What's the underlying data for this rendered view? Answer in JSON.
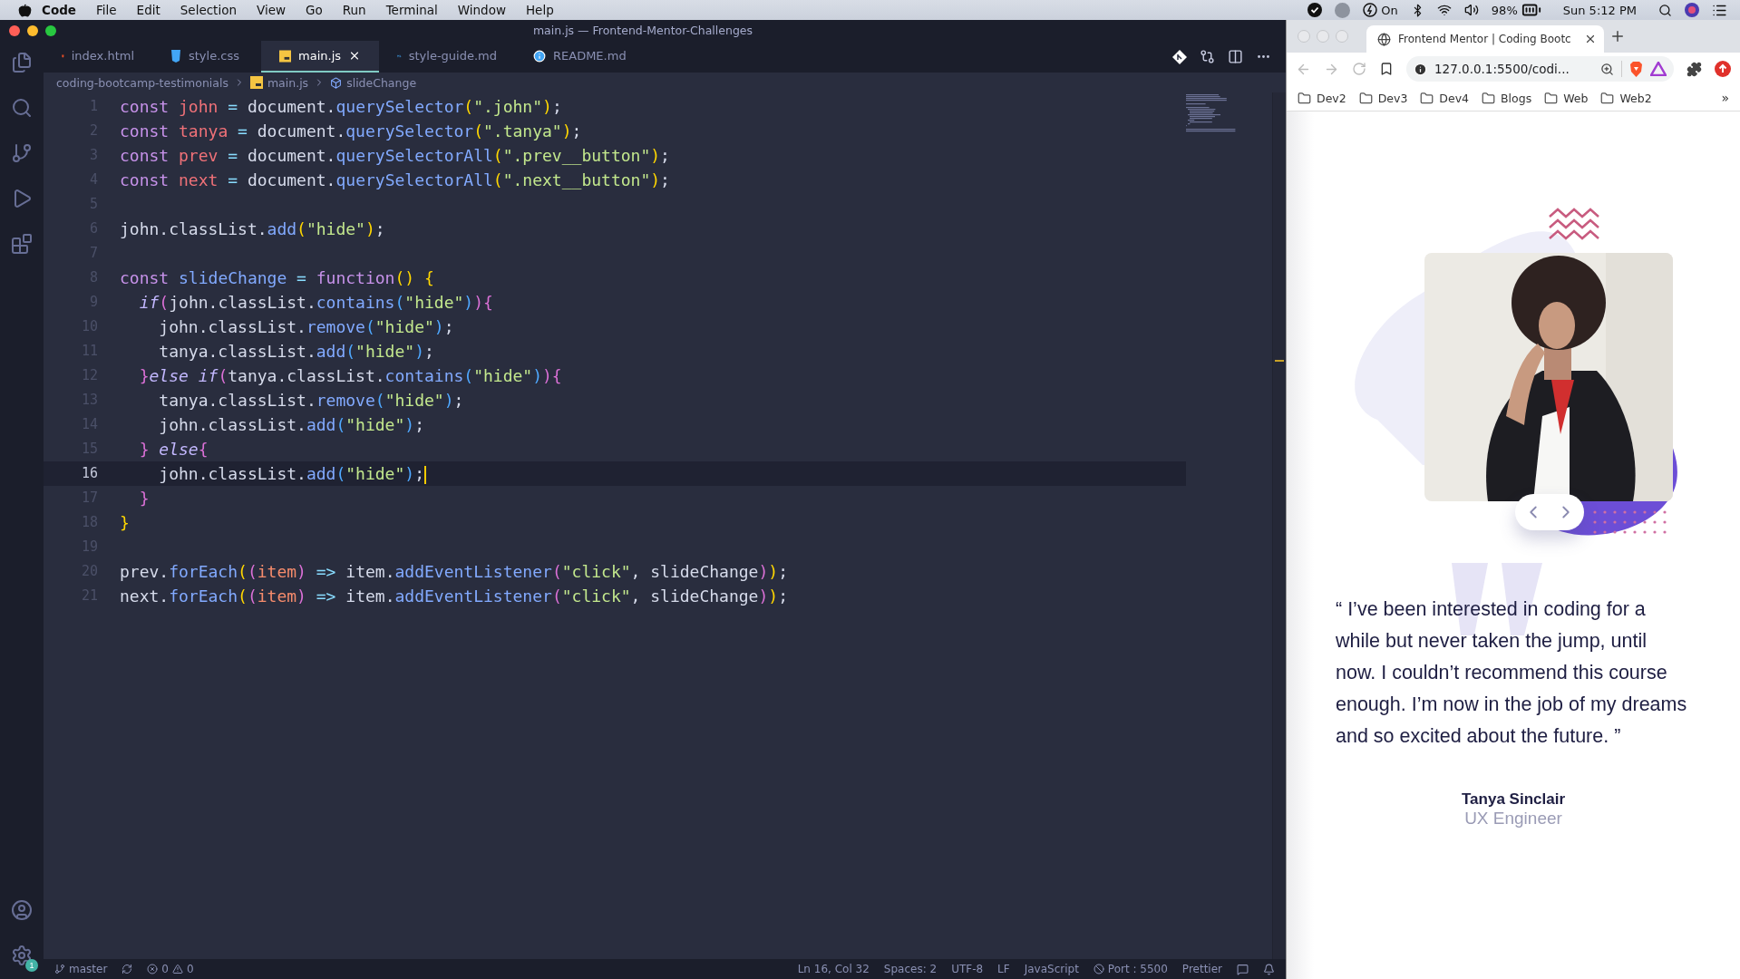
{
  "menubar": {
    "app": "Code",
    "menus": [
      "File",
      "Edit",
      "Selection",
      "View",
      "Go",
      "Run",
      "Terminal",
      "Window",
      "Help"
    ],
    "focus": "On",
    "battery": "98%",
    "clock": "Sun 5:12 PM"
  },
  "editor": {
    "title": "main.js — Frontend-Mentor-Challenges",
    "tabs": [
      {
        "label": "index.html",
        "kind": "html",
        "selected": false
      },
      {
        "label": "style.css",
        "kind": "css",
        "selected": false
      },
      {
        "label": "main.js",
        "kind": "js",
        "selected": true
      },
      {
        "label": "style-guide.md",
        "kind": "md",
        "selected": false
      },
      {
        "label": "README.md",
        "kind": "info",
        "selected": false
      }
    ],
    "breadcrumb": [
      {
        "label": "coding-bootcamp-testimonials",
        "kind": "folder"
      },
      {
        "label": "main.js",
        "kind": "js"
      },
      {
        "label": "slideChange",
        "kind": "symbol"
      }
    ],
    "settings_badge": "1",
    "lines": [
      {
        "number": "1",
        "current": false,
        "tokens": [
          {
            "kind": "kw",
            "s": "const "
          },
          {
            "kind": "var",
            "s": "john"
          },
          {
            "kind": "op",
            "s": " = "
          },
          {
            "kind": "pl",
            "s": "document."
          },
          {
            "kind": "fn",
            "s": "querySelector"
          },
          {
            "kind": "p1",
            "s": "("
          },
          {
            "kind": "str",
            "s": "\".john\""
          },
          {
            "kind": "p1",
            "s": ")"
          },
          {
            "kind": "pl",
            "s": ";"
          }
        ]
      },
      {
        "number": "2",
        "current": false,
        "tokens": [
          {
            "kind": "kw",
            "s": "const "
          },
          {
            "kind": "var",
            "s": "tanya"
          },
          {
            "kind": "op",
            "s": " = "
          },
          {
            "kind": "pl",
            "s": "document."
          },
          {
            "kind": "fn",
            "s": "querySelector"
          },
          {
            "kind": "p1",
            "s": "("
          },
          {
            "kind": "str",
            "s": "\".tanya\""
          },
          {
            "kind": "p1",
            "s": ")"
          },
          {
            "kind": "pl",
            "s": ";"
          }
        ]
      },
      {
        "number": "3",
        "current": false,
        "tokens": [
          {
            "kind": "kw",
            "s": "const "
          },
          {
            "kind": "var",
            "s": "prev"
          },
          {
            "kind": "op",
            "s": " = "
          },
          {
            "kind": "pl",
            "s": "document."
          },
          {
            "kind": "fn",
            "s": "querySelectorAll"
          },
          {
            "kind": "p1",
            "s": "("
          },
          {
            "kind": "str",
            "s": "\".prev__button\""
          },
          {
            "kind": "p1",
            "s": ")"
          },
          {
            "kind": "pl",
            "s": ";"
          }
        ]
      },
      {
        "number": "4",
        "current": false,
        "tokens": [
          {
            "kind": "kw",
            "s": "const "
          },
          {
            "kind": "var",
            "s": "next"
          },
          {
            "kind": "op",
            "s": " = "
          },
          {
            "kind": "pl",
            "s": "document."
          },
          {
            "kind": "fn",
            "s": "querySelectorAll"
          },
          {
            "kind": "p1",
            "s": "("
          },
          {
            "kind": "str",
            "s": "\".next__button\""
          },
          {
            "kind": "p1",
            "s": ")"
          },
          {
            "kind": "pl",
            "s": ";"
          }
        ]
      },
      {
        "number": "5",
        "current": false
      },
      {
        "number": "6",
        "current": false,
        "tokens": [
          {
            "kind": "pl",
            "s": "john.classList."
          },
          {
            "kind": "fn",
            "s": "add"
          },
          {
            "kind": "p1",
            "s": "("
          },
          {
            "kind": "str",
            "s": "\"hide\""
          },
          {
            "kind": "p1",
            "s": ")"
          },
          {
            "kind": "pl",
            "s": ";"
          }
        ]
      },
      {
        "number": "7",
        "current": false
      },
      {
        "number": "8",
        "current": false,
        "tokens": [
          {
            "kind": "kw",
            "s": "const "
          },
          {
            "kind": "fn",
            "s": "slideChange"
          },
          {
            "kind": "op",
            "s": " = "
          },
          {
            "kind": "kw",
            "s": "function"
          },
          {
            "kind": "p1",
            "s": "() {"
          }
        ]
      },
      {
        "number": "9",
        "current": false,
        "tokens": [
          {
            "kind": "ctrl",
            "s": "  if"
          },
          {
            "kind": "p2",
            "s": "("
          },
          {
            "kind": "pl",
            "s": "john.classList."
          },
          {
            "kind": "fn",
            "s": "contains"
          },
          {
            "kind": "p3",
            "s": "("
          },
          {
            "kind": "str",
            "s": "\"hide\""
          },
          {
            "kind": "p3",
            "s": ")"
          },
          {
            "kind": "p2",
            "s": "){"
          }
        ]
      },
      {
        "number": "10",
        "current": false,
        "tokens": [
          {
            "kind": "pl",
            "s": "    john.classList."
          },
          {
            "kind": "fn",
            "s": "remove"
          },
          {
            "kind": "p3",
            "s": "("
          },
          {
            "kind": "str",
            "s": "\"hide\""
          },
          {
            "kind": "p3",
            "s": ")"
          },
          {
            "kind": "pl",
            "s": ";"
          }
        ]
      },
      {
        "number": "11",
        "current": false,
        "tokens": [
          {
            "kind": "pl",
            "s": "    tanya.classList."
          },
          {
            "kind": "fn",
            "s": "add"
          },
          {
            "kind": "p3",
            "s": "("
          },
          {
            "kind": "str",
            "s": "\"hide\""
          },
          {
            "kind": "p3",
            "s": ")"
          },
          {
            "kind": "pl",
            "s": ";"
          }
        ]
      },
      {
        "number": "12",
        "current": false,
        "tokens": [
          {
            "kind": "p2",
            "s": "  }"
          },
          {
            "kind": "ctrl",
            "s": "else if"
          },
          {
            "kind": "p2",
            "s": "("
          },
          {
            "kind": "pl",
            "s": "tanya.classList."
          },
          {
            "kind": "fn",
            "s": "contains"
          },
          {
            "kind": "p3",
            "s": "("
          },
          {
            "kind": "str",
            "s": "\"hide\""
          },
          {
            "kind": "p3",
            "s": ")"
          },
          {
            "kind": "p2",
            "s": "){"
          }
        ]
      },
      {
        "number": "13",
        "current": false,
        "tokens": [
          {
            "kind": "pl",
            "s": "    tanya.classList."
          },
          {
            "kind": "fn",
            "s": "remove"
          },
          {
            "kind": "p3",
            "s": "("
          },
          {
            "kind": "str",
            "s": "\"hide\""
          },
          {
            "kind": "p3",
            "s": ")"
          },
          {
            "kind": "pl",
            "s": ";"
          }
        ]
      },
      {
        "number": "14",
        "current": false,
        "tokens": [
          {
            "kind": "pl",
            "s": "    john.classList."
          },
          {
            "kind": "fn",
            "s": "add"
          },
          {
            "kind": "p3",
            "s": "("
          },
          {
            "kind": "str",
            "s": "\"hide\""
          },
          {
            "kind": "p3",
            "s": ")"
          },
          {
            "kind": "pl",
            "s": ";"
          }
        ]
      },
      {
        "number": "15",
        "current": false,
        "tokens": [
          {
            "kind": "p2",
            "s": "  } "
          },
          {
            "kind": "ctrl",
            "s": "else"
          },
          {
            "kind": "p2",
            "s": "{"
          }
        ]
      },
      {
        "number": "16",
        "current": true,
        "tokens": [
          {
            "kind": "pl",
            "s": "    john.classList."
          },
          {
            "kind": "fn",
            "s": "add"
          },
          {
            "kind": "p3",
            "s": "("
          },
          {
            "kind": "str",
            "s": "\"hide\""
          },
          {
            "kind": "p3",
            "s": ")"
          },
          {
            "kind": "pl",
            "s": ";"
          }
        ]
      },
      {
        "number": "17",
        "current": false,
        "tokens": [
          {
            "kind": "p2",
            "s": "  }"
          }
        ]
      },
      {
        "number": "18",
        "current": false,
        "tokens": [
          {
            "kind": "p1",
            "s": "}"
          }
        ]
      },
      {
        "number": "19",
        "current": false
      },
      {
        "number": "20",
        "current": false,
        "tokens": [
          {
            "kind": "pl",
            "s": "prev."
          },
          {
            "kind": "fn",
            "s": "forEach"
          },
          {
            "kind": "p1",
            "s": "("
          },
          {
            "kind": "p2",
            "s": "("
          },
          {
            "kind": "param",
            "s": "item"
          },
          {
            "kind": "p2",
            "s": ")"
          },
          {
            "kind": "op",
            "s": " => "
          },
          {
            "kind": "pl",
            "s": "item."
          },
          {
            "kind": "fn",
            "s": "addEventListener"
          },
          {
            "kind": "p2",
            "s": "("
          },
          {
            "kind": "str",
            "s": "\"click\""
          },
          {
            "kind": "pl",
            "s": ", slideChange"
          },
          {
            "kind": "p2",
            "s": ")"
          },
          {
            "kind": "p1",
            "s": ")"
          },
          {
            "kind": "pl",
            "s": ";"
          }
        ]
      },
      {
        "number": "21",
        "current": false,
        "tokens": [
          {
            "kind": "pl",
            "s": "next."
          },
          {
            "kind": "fn",
            "s": "forEach"
          },
          {
            "kind": "p1",
            "s": "("
          },
          {
            "kind": "p2",
            "s": "("
          },
          {
            "kind": "param",
            "s": "item"
          },
          {
            "kind": "p2",
            "s": ")"
          },
          {
            "kind": "op",
            "s": " => "
          },
          {
            "kind": "pl",
            "s": "item."
          },
          {
            "kind": "fn",
            "s": "addEventListener"
          },
          {
            "kind": "p2",
            "s": "("
          },
          {
            "kind": "str",
            "s": "\"click\""
          },
          {
            "kind": "pl",
            "s": ", slideChange"
          },
          {
            "kind": "p2",
            "s": ")"
          },
          {
            "kind": "p1",
            "s": ")"
          },
          {
            "kind": "pl",
            "s": ";"
          }
        ]
      }
    ],
    "status_bar": {
      "branch": "master",
      "errors": "0",
      "warnings": "0",
      "right": [
        {
          "label": "Ln 16, Col 32",
          "kind": "text"
        },
        {
          "label": "Spaces: 2",
          "kind": "text"
        },
        {
          "label": "UTF-8",
          "kind": "text"
        },
        {
          "label": "LF",
          "kind": "text"
        },
        {
          "label": "JavaScript",
          "kind": "text"
        },
        {
          "label": "Port : 5500",
          "kind": "port"
        },
        {
          "label": "Prettier",
          "kind": "text"
        }
      ]
    }
  },
  "browser": {
    "tab_title": "Frontend Mentor | Coding Bootc",
    "url": "127.0.0.1:5500/codi...",
    "bookmarks": [
      "Dev2",
      "Dev3",
      "Dev4",
      "Blogs",
      "Web",
      "Web2"
    ],
    "overflow": "»",
    "page": {
      "quote": "“ I’ve been interested in coding for a while but never taken the jump, until now. I couldn’t recommend this course enough. I’m now in the job of my dreams and so excited about the future. ”",
      "name": "Tanya Sinclair",
      "role": "UX Engineer"
    }
  }
}
